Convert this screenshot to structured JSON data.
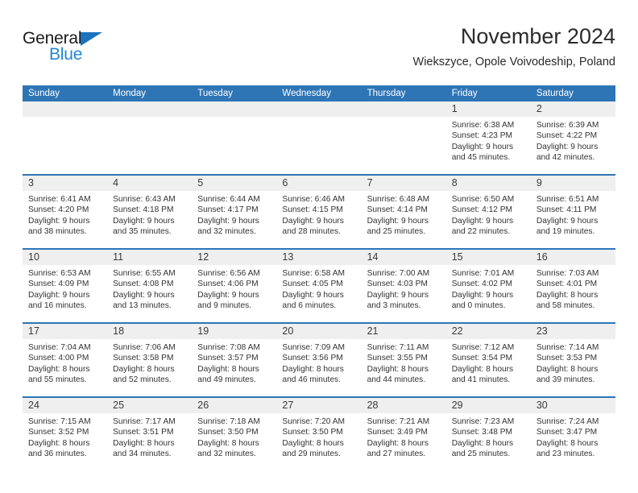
{
  "logo": {
    "word_top": "General",
    "word_bottom": "Blue",
    "triangle_color": "#1b72bd",
    "blue_text_color": "#2287d6"
  },
  "header": {
    "month_title": "November 2024",
    "location": "Wiekszyce, Opole Voivodeship, Poland"
  },
  "colors": {
    "header_blue": "#2e75b6",
    "day_band_gray": "#efefef",
    "text": "#333333"
  },
  "weekdays": [
    "Sunday",
    "Monday",
    "Tuesday",
    "Wednesday",
    "Thursday",
    "Friday",
    "Saturday"
  ],
  "weeks": [
    [
      {
        "num": "",
        "sunrise": "",
        "sunset": "",
        "daylight_line1": "",
        "daylight_line2": ""
      },
      {
        "num": "",
        "sunrise": "",
        "sunset": "",
        "daylight_line1": "",
        "daylight_line2": ""
      },
      {
        "num": "",
        "sunrise": "",
        "sunset": "",
        "daylight_line1": "",
        "daylight_line2": ""
      },
      {
        "num": "",
        "sunrise": "",
        "sunset": "",
        "daylight_line1": "",
        "daylight_line2": ""
      },
      {
        "num": "",
        "sunrise": "",
        "sunset": "",
        "daylight_line1": "",
        "daylight_line2": ""
      },
      {
        "num": "1",
        "sunrise": "Sunrise: 6:38 AM",
        "sunset": "Sunset: 4:23 PM",
        "daylight_line1": "Daylight: 9 hours",
        "daylight_line2": "and 45 minutes."
      },
      {
        "num": "2",
        "sunrise": "Sunrise: 6:39 AM",
        "sunset": "Sunset: 4:22 PM",
        "daylight_line1": "Daylight: 9 hours",
        "daylight_line2": "and 42 minutes."
      }
    ],
    [
      {
        "num": "3",
        "sunrise": "Sunrise: 6:41 AM",
        "sunset": "Sunset: 4:20 PM",
        "daylight_line1": "Daylight: 9 hours",
        "daylight_line2": "and 38 minutes."
      },
      {
        "num": "4",
        "sunrise": "Sunrise: 6:43 AM",
        "sunset": "Sunset: 4:18 PM",
        "daylight_line1": "Daylight: 9 hours",
        "daylight_line2": "and 35 minutes."
      },
      {
        "num": "5",
        "sunrise": "Sunrise: 6:44 AM",
        "sunset": "Sunset: 4:17 PM",
        "daylight_line1": "Daylight: 9 hours",
        "daylight_line2": "and 32 minutes."
      },
      {
        "num": "6",
        "sunrise": "Sunrise: 6:46 AM",
        "sunset": "Sunset: 4:15 PM",
        "daylight_line1": "Daylight: 9 hours",
        "daylight_line2": "and 28 minutes."
      },
      {
        "num": "7",
        "sunrise": "Sunrise: 6:48 AM",
        "sunset": "Sunset: 4:14 PM",
        "daylight_line1": "Daylight: 9 hours",
        "daylight_line2": "and 25 minutes."
      },
      {
        "num": "8",
        "sunrise": "Sunrise: 6:50 AM",
        "sunset": "Sunset: 4:12 PM",
        "daylight_line1": "Daylight: 9 hours",
        "daylight_line2": "and 22 minutes."
      },
      {
        "num": "9",
        "sunrise": "Sunrise: 6:51 AM",
        "sunset": "Sunset: 4:11 PM",
        "daylight_line1": "Daylight: 9 hours",
        "daylight_line2": "and 19 minutes."
      }
    ],
    [
      {
        "num": "10",
        "sunrise": "Sunrise: 6:53 AM",
        "sunset": "Sunset: 4:09 PM",
        "daylight_line1": "Daylight: 9 hours",
        "daylight_line2": "and 16 minutes."
      },
      {
        "num": "11",
        "sunrise": "Sunrise: 6:55 AM",
        "sunset": "Sunset: 4:08 PM",
        "daylight_line1": "Daylight: 9 hours",
        "daylight_line2": "and 13 minutes."
      },
      {
        "num": "12",
        "sunrise": "Sunrise: 6:56 AM",
        "sunset": "Sunset: 4:06 PM",
        "daylight_line1": "Daylight: 9 hours",
        "daylight_line2": "and 9 minutes."
      },
      {
        "num": "13",
        "sunrise": "Sunrise: 6:58 AM",
        "sunset": "Sunset: 4:05 PM",
        "daylight_line1": "Daylight: 9 hours",
        "daylight_line2": "and 6 minutes."
      },
      {
        "num": "14",
        "sunrise": "Sunrise: 7:00 AM",
        "sunset": "Sunset: 4:03 PM",
        "daylight_line1": "Daylight: 9 hours",
        "daylight_line2": "and 3 minutes."
      },
      {
        "num": "15",
        "sunrise": "Sunrise: 7:01 AM",
        "sunset": "Sunset: 4:02 PM",
        "daylight_line1": "Daylight: 9 hours",
        "daylight_line2": "and 0 minutes."
      },
      {
        "num": "16",
        "sunrise": "Sunrise: 7:03 AM",
        "sunset": "Sunset: 4:01 PM",
        "daylight_line1": "Daylight: 8 hours",
        "daylight_line2": "and 58 minutes."
      }
    ],
    [
      {
        "num": "17",
        "sunrise": "Sunrise: 7:04 AM",
        "sunset": "Sunset: 4:00 PM",
        "daylight_line1": "Daylight: 8 hours",
        "daylight_line2": "and 55 minutes."
      },
      {
        "num": "18",
        "sunrise": "Sunrise: 7:06 AM",
        "sunset": "Sunset: 3:58 PM",
        "daylight_line1": "Daylight: 8 hours",
        "daylight_line2": "and 52 minutes."
      },
      {
        "num": "19",
        "sunrise": "Sunrise: 7:08 AM",
        "sunset": "Sunset: 3:57 PM",
        "daylight_line1": "Daylight: 8 hours",
        "daylight_line2": "and 49 minutes."
      },
      {
        "num": "20",
        "sunrise": "Sunrise: 7:09 AM",
        "sunset": "Sunset: 3:56 PM",
        "daylight_line1": "Daylight: 8 hours",
        "daylight_line2": "and 46 minutes."
      },
      {
        "num": "21",
        "sunrise": "Sunrise: 7:11 AM",
        "sunset": "Sunset: 3:55 PM",
        "daylight_line1": "Daylight: 8 hours",
        "daylight_line2": "and 44 minutes."
      },
      {
        "num": "22",
        "sunrise": "Sunrise: 7:12 AM",
        "sunset": "Sunset: 3:54 PM",
        "daylight_line1": "Daylight: 8 hours",
        "daylight_line2": "and 41 minutes."
      },
      {
        "num": "23",
        "sunrise": "Sunrise: 7:14 AM",
        "sunset": "Sunset: 3:53 PM",
        "daylight_line1": "Daylight: 8 hours",
        "daylight_line2": "and 39 minutes."
      }
    ],
    [
      {
        "num": "24",
        "sunrise": "Sunrise: 7:15 AM",
        "sunset": "Sunset: 3:52 PM",
        "daylight_line1": "Daylight: 8 hours",
        "daylight_line2": "and 36 minutes."
      },
      {
        "num": "25",
        "sunrise": "Sunrise: 7:17 AM",
        "sunset": "Sunset: 3:51 PM",
        "daylight_line1": "Daylight: 8 hours",
        "daylight_line2": "and 34 minutes."
      },
      {
        "num": "26",
        "sunrise": "Sunrise: 7:18 AM",
        "sunset": "Sunset: 3:50 PM",
        "daylight_line1": "Daylight: 8 hours",
        "daylight_line2": "and 32 minutes."
      },
      {
        "num": "27",
        "sunrise": "Sunrise: 7:20 AM",
        "sunset": "Sunset: 3:50 PM",
        "daylight_line1": "Daylight: 8 hours",
        "daylight_line2": "and 29 minutes."
      },
      {
        "num": "28",
        "sunrise": "Sunrise: 7:21 AM",
        "sunset": "Sunset: 3:49 PM",
        "daylight_line1": "Daylight: 8 hours",
        "daylight_line2": "and 27 minutes."
      },
      {
        "num": "29",
        "sunrise": "Sunrise: 7:23 AM",
        "sunset": "Sunset: 3:48 PM",
        "daylight_line1": "Daylight: 8 hours",
        "daylight_line2": "and 25 minutes."
      },
      {
        "num": "30",
        "sunrise": "Sunrise: 7:24 AM",
        "sunset": "Sunset: 3:47 PM",
        "daylight_line1": "Daylight: 8 hours",
        "daylight_line2": "and 23 minutes."
      }
    ]
  ]
}
